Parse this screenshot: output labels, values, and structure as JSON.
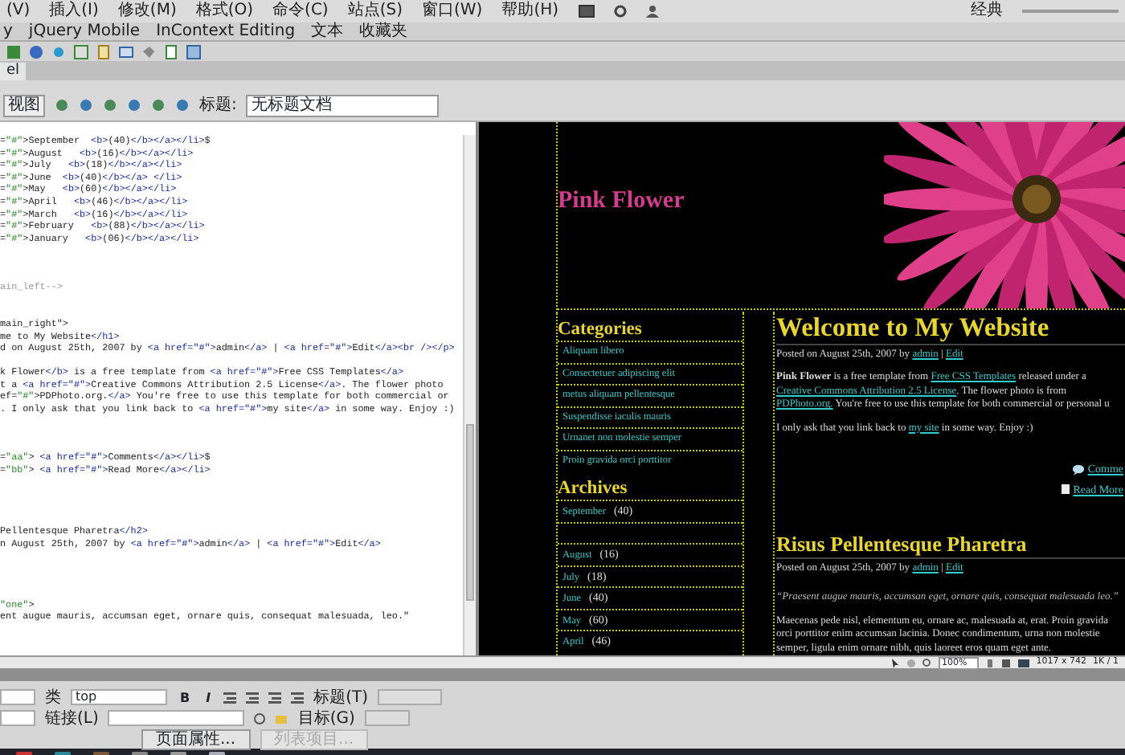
{
  "menu_bar": {
    "items": [
      "(V)",
      "插入(I)",
      "修改(M)",
      "格式(O)",
      "命令(C)",
      "站点(S)",
      "窗口(W)",
      "帮助(H)"
    ],
    "workspace": "经典"
  },
  "insert_tabs": [
    "y",
    "jQuery Mobile",
    "InContext Editing",
    "文本",
    "收藏夹"
  ],
  "document_tab": {
    "label": "el"
  },
  "document_toolbar": {
    "view_button": "视图",
    "title_label": "标题:",
    "title_value": "无标题文档"
  },
  "code_view": {
    "lines": [
      {
        "kind": "code",
        "text": "=\"#\">September  <b>(40)</b></a></li>$"
      },
      {
        "kind": "code",
        "text": "=\"#\">August   <b>(16)</b></a></li>"
      },
      {
        "kind": "code",
        "text": "=\"#\">July   <b>(18)</b></a></li>"
      },
      {
        "kind": "code",
        "text": "=\"#\">June  <b>(40)</b></a> </li>"
      },
      {
        "kind": "code",
        "text": "=\"#\">May   <b>(60)</b></a></li>"
      },
      {
        "kind": "code",
        "text": "=\"#\">April   <b>(46)</b></a></li>"
      },
      {
        "kind": "code",
        "text": "=\"#\">March   <b>(16)</b></a></li>"
      },
      {
        "kind": "code",
        "text": "=\"#\">February   <b>(88)</b></a></li>"
      },
      {
        "kind": "code",
        "text": "=\"#\">January   <b>(06)</b></a></li>"
      },
      {
        "kind": "blank"
      },
      {
        "kind": "blank"
      },
      {
        "kind": "blank"
      },
      {
        "kind": "comment",
        "text": "ain_left-->"
      },
      {
        "kind": "blank"
      },
      {
        "kind": "blank"
      },
      {
        "kind": "code",
        "text": "main_right\">"
      },
      {
        "kind": "code",
        "text": "me to My Website</h1>"
      },
      {
        "kind": "code",
        "text": "d on August 25th, 2007 by <a href=\"#\">admin</a> | <a href=\"#\">Edit</a><br /></p>"
      },
      {
        "kind": "blank"
      },
      {
        "kind": "code",
        "text": "k Flower</b> is a free template from <a href=\"#\">Free CSS Templates</a>"
      },
      {
        "kind": "code",
        "text": "t a <a href=\"#\">Creative Commons Attribution 2.5 License</a>. The flower photo"
      },
      {
        "kind": "code",
        "text": "ef=\"#\">PDPhoto.org.</a> You're free to use this template for both commercial or"
      },
      {
        "kind": "code",
        "text": ". I only ask that you link back to <a href=\"#\">my site</a> in some way. Enjoy :)"
      },
      {
        "kind": "blank"
      },
      {
        "kind": "blank"
      },
      {
        "kind": "blank"
      },
      {
        "kind": "code",
        "text": "=\"aa\"> <a href=\"#\">Comments</a></li>$"
      },
      {
        "kind": "code",
        "text": "=\"bb\"> <a href=\"#\">Read More</a></li>"
      },
      {
        "kind": "blank"
      },
      {
        "kind": "blank"
      },
      {
        "kind": "blank"
      },
      {
        "kind": "blank"
      },
      {
        "kind": "code",
        "text": "Pellentesque Pharetra</h2>"
      },
      {
        "kind": "code",
        "text": "n August 25th, 2007 by <a href=\"#\">admin</a> | <a href=\"#\">Edit</a>"
      },
      {
        "kind": "blank"
      },
      {
        "kind": "blank"
      },
      {
        "kind": "blank"
      },
      {
        "kind": "blank"
      },
      {
        "kind": "code",
        "text": "\"one\">"
      },
      {
        "kind": "code",
        "text": "ent augue mauris, accumsan eget, ornare quis, consequat malesuada, leo.\""
      }
    ]
  },
  "design_view": {
    "site_title": "Pink Flower",
    "categories": {
      "heading": "Categories",
      "items": [
        "Aliquam libero",
        "Consectetuer adipiscing elit",
        "metus aliquam pellentesque",
        "Suspendisse iaculis mauris",
        "Urnanet non molestie semper",
        "Proin gravida orci porttitor"
      ]
    },
    "archives": {
      "heading": "Archives",
      "items": [
        {
          "kind": "month",
          "month": "September",
          "count": "(40)"
        },
        {
          "kind": "empty"
        },
        {
          "kind": "month",
          "month": "August",
          "count": "(16)"
        },
        {
          "kind": "month",
          "month": "July",
          "count": "(18)"
        },
        {
          "kind": "month",
          "month": "June",
          "count": "(40)"
        },
        {
          "kind": "month",
          "month": "May",
          "count": "(60)"
        },
        {
          "kind": "month",
          "month": "April",
          "count": "(46)"
        }
      ]
    },
    "posts": [
      {
        "title": "Welcome to My Website",
        "meta": [
          {
            "kind": "text",
            "text": "Posted on August 25th, 2007 by "
          },
          {
            "kind": "link",
            "text": "admin"
          },
          {
            "kind": "text",
            "text": " | "
          },
          {
            "kind": "link",
            "text": "Edit"
          }
        ],
        "paragraphs": [
          {
            "kind": "text",
            "parts": [
              {
                "kind": "bold",
                "text": "Pink Flower"
              },
              {
                "kind": "text",
                "text": " is a free template from "
              },
              {
                "kind": "link",
                "text": "Free CSS Templates"
              },
              {
                "kind": "text",
                "text": " released under a "
              },
              {
                "kind": "link",
                "text": "Creative Commons Attribution 2.5 License"
              },
              {
                "kind": "text",
                "text": ". The flower photo is from "
              },
              {
                "kind": "link",
                "text": "PDPhoto.org."
              },
              {
                "kind": "text",
                "text": " You're free to use this template for both commercial or personal u"
              }
            ]
          },
          {
            "kind": "text",
            "parts": [
              {
                "kind": "text",
                "text": "I only ask that you link back to "
              },
              {
                "kind": "link",
                "text": "my site"
              },
              {
                "kind": "text",
                "text": " in some way. Enjoy :)"
              }
            ]
          }
        ],
        "links": [
          {
            "kind": "comments",
            "label": "Comme"
          },
          {
            "kind": "readmore",
            "label": "Read More"
          }
        ]
      },
      {
        "title": "Risus Pellentesque Pharetra",
        "meta": [
          {
            "kind": "text",
            "text": "Posted on August 25th, 2007 by "
          },
          {
            "kind": "link",
            "text": "admin"
          },
          {
            "kind": "text",
            "text": " | "
          },
          {
            "kind": "link",
            "text": "Edit"
          }
        ],
        "paragraphs": [
          {
            "kind": "quote",
            "parts": [
              {
                "kind": "text",
                "text": "“Praesent augue mauris, accumsan eget, ornare quis, consequat malesuada leo.”"
              }
            ]
          },
          {
            "kind": "text",
            "parts": [
              {
                "kind": "text",
                "text": "Maecenas pede nisl, elementum eu, ornare ac, malesuada at, erat. Proin gravida orci porttitor enim accumsan lacinia. Donec condimentum, urna non molestie semper, ligula enim ornare nibh, quis laoreet eros quam eget ante."
              }
            ]
          }
        ]
      }
    ]
  },
  "status_bar": {
    "zoom": "100%",
    "window_size": "1017 x 742",
    "download": "1K / 1"
  },
  "properties": {
    "class_label": "类",
    "class_value": "top",
    "bold": "B",
    "italic": "I",
    "title_label": "标题(T)",
    "link_label": "链接(L)",
    "target_label": "目标(G)",
    "buttons": [
      {
        "label": "页面属性...",
        "disabled": false
      },
      {
        "label": "列表项目...",
        "disabled": true
      }
    ]
  }
}
